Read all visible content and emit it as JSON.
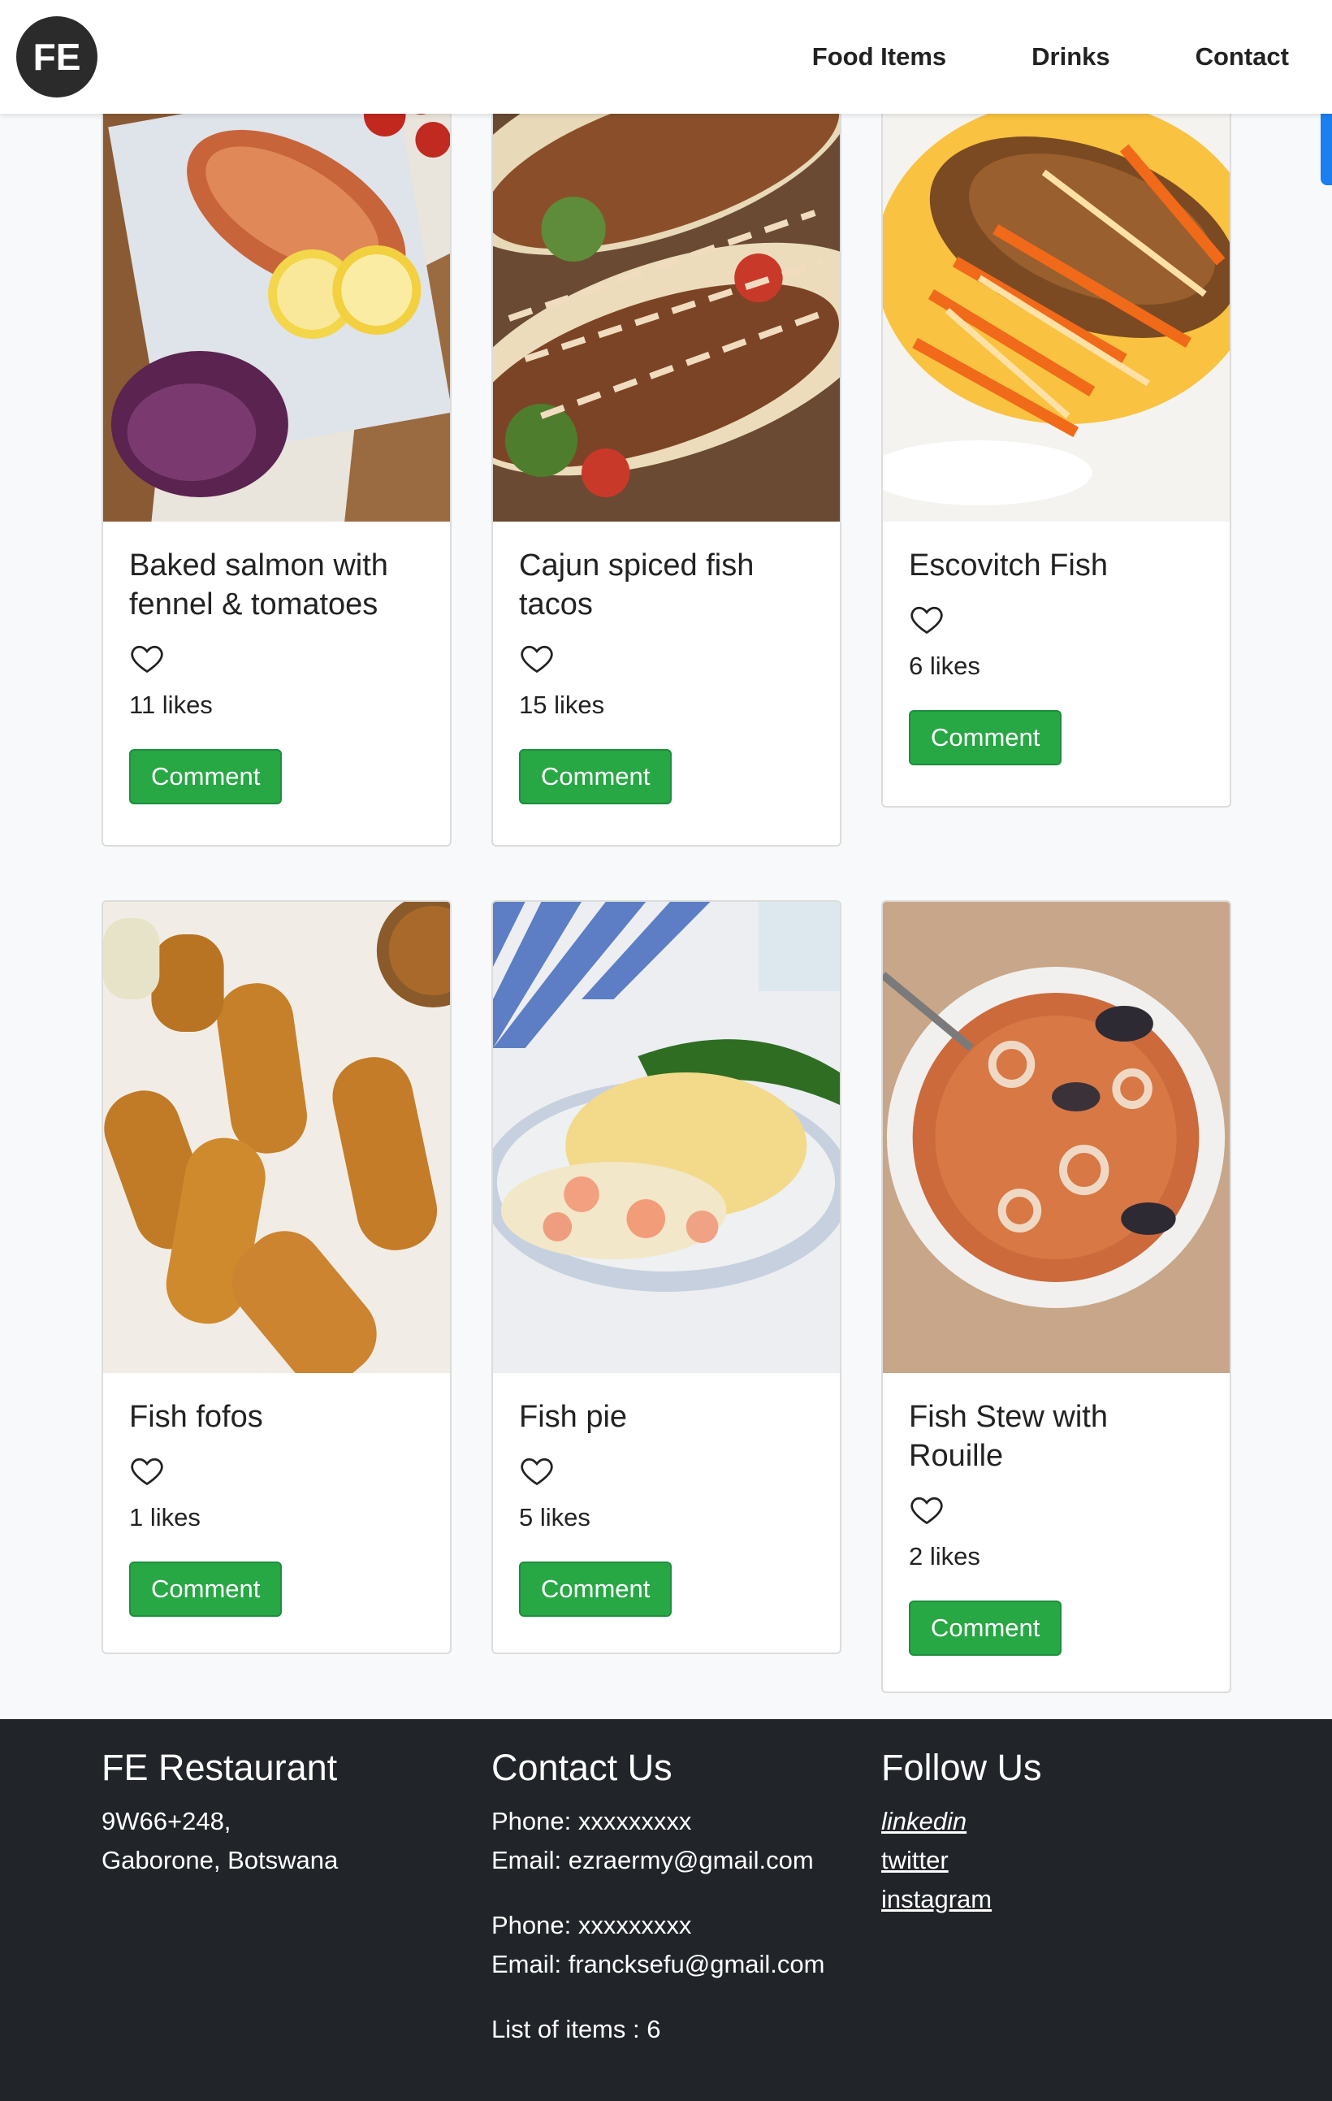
{
  "header": {
    "logo": "FE",
    "nav": [
      "Food Items",
      "Drinks",
      "Contact"
    ]
  },
  "cards": [
    {
      "title": "Baked salmon with fennel & tomatoes",
      "likes": "11 likes",
      "button": "Comment",
      "image": "baked-salmon-photo"
    },
    {
      "title": "Cajun spiced fish tacos",
      "likes": "15 likes",
      "button": "Comment",
      "image": "fish-tacos-photo"
    },
    {
      "title": "Escovitch Fish",
      "likes": "6 likes",
      "button": "Comment",
      "image": "escovitch-fish-photo"
    },
    {
      "title": "Fish fofos",
      "likes": "1 likes",
      "button": "Comment",
      "image": "fish-fofos-photo"
    },
    {
      "title": "Fish pie",
      "likes": "5 likes",
      "button": "Comment",
      "image": "fish-pie-photo"
    },
    {
      "title": "Fish Stew with Rouille",
      "likes": "2 likes",
      "button": "Comment",
      "image": "fish-stew-photo"
    }
  ],
  "footer": {
    "restaurant": {
      "heading": "FE Restaurant",
      "address1": "9W66+248,",
      "address2": "Gaborone, Botswana"
    },
    "contact": {
      "heading": "Contact Us",
      "phone1": "Phone: xxxxxxxxx",
      "email1": "Email: ezraermy@gmail.com",
      "phone2": "Phone: xxxxxxxxx",
      "email2": "Email: francksefu@gmail.com",
      "count": "List of items : 6"
    },
    "follow": {
      "heading": "Follow Us",
      "links": [
        "linkedin",
        "twitter",
        "instagram"
      ]
    }
  },
  "colors": {
    "accent": "#28a745",
    "footer_bg": "#212529",
    "scroll_tab": "#1b7ff0"
  }
}
